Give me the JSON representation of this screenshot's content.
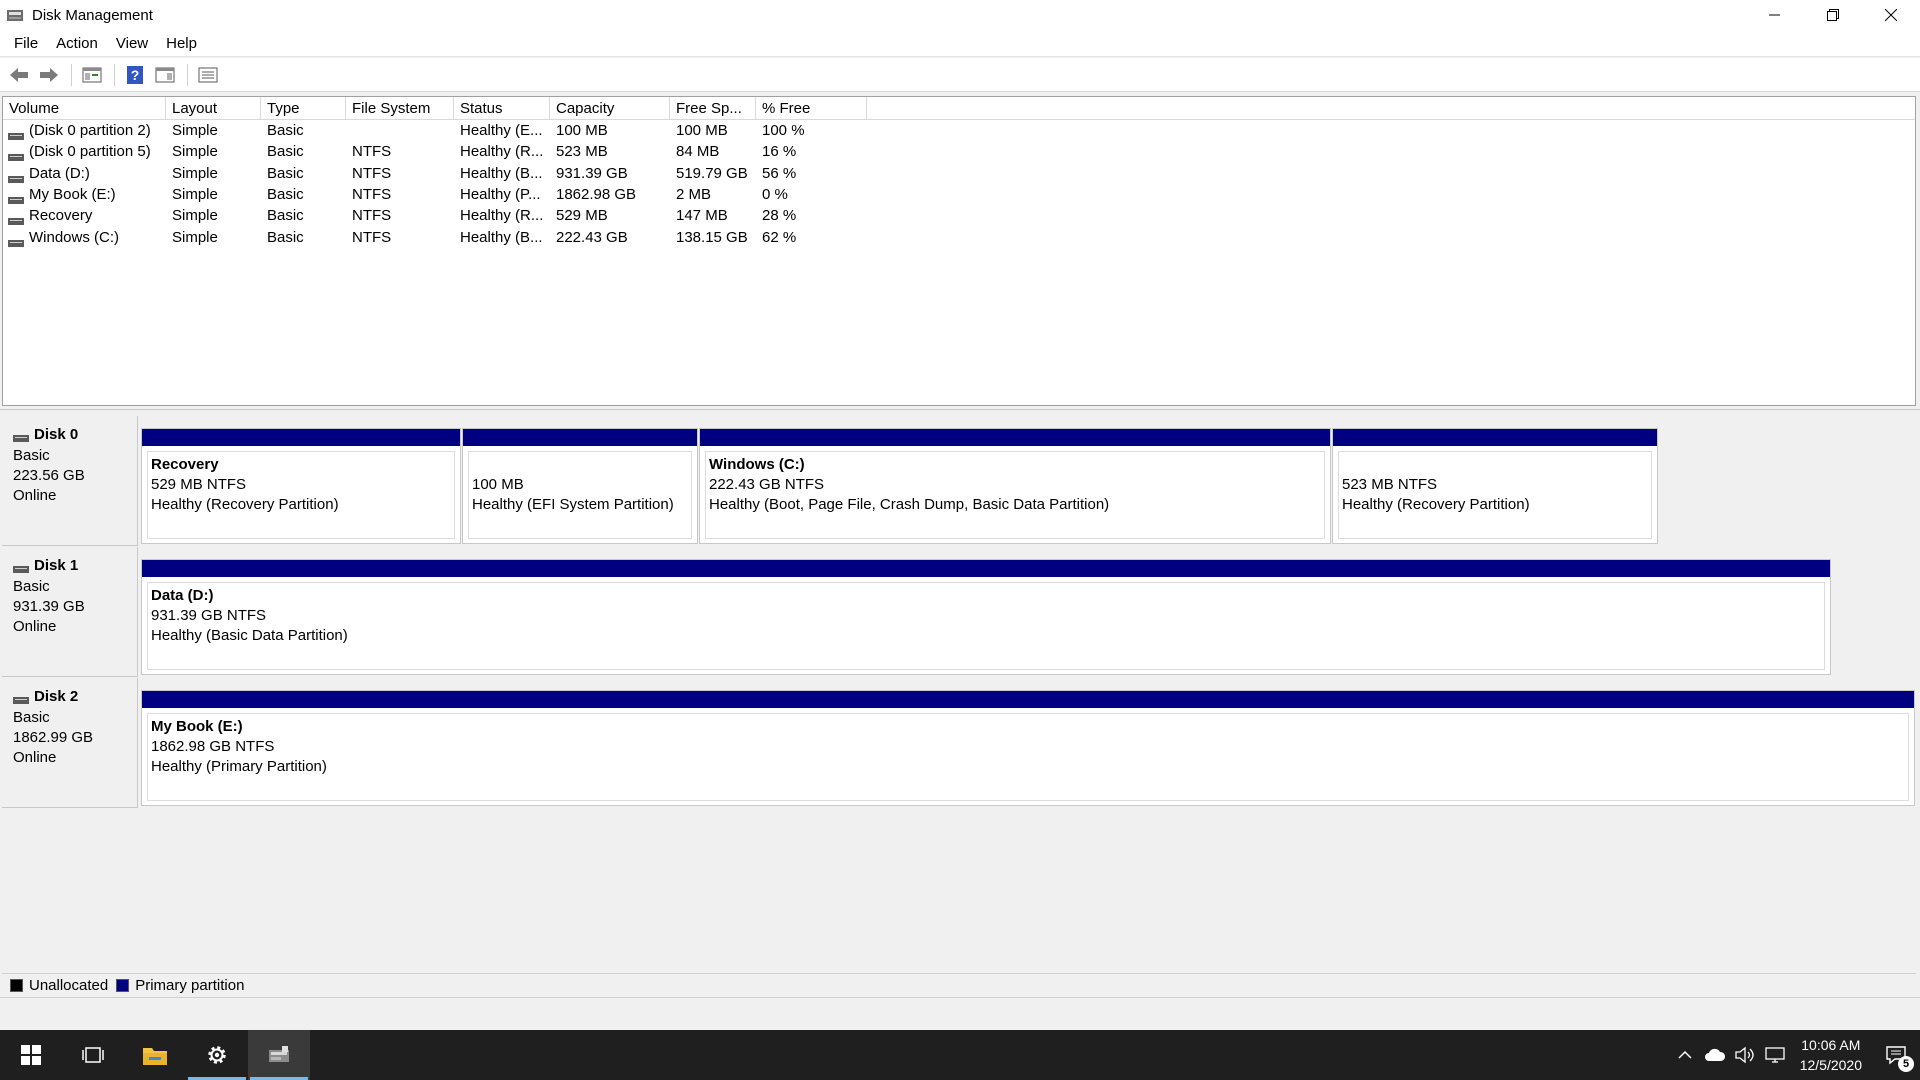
{
  "window": {
    "title": "Disk Management"
  },
  "menu": [
    "File",
    "Action",
    "View",
    "Help"
  ],
  "list": {
    "columns": [
      "Volume",
      "Layout",
      "Type",
      "File System",
      "Status",
      "Capacity",
      "Free Sp...",
      "% Free"
    ],
    "rows": [
      [
        "(Disk 0 partition 2)",
        "Simple",
        "Basic",
        "",
        "Healthy (E...",
        "100 MB",
        "100 MB",
        "100 %"
      ],
      [
        "(Disk 0 partition 5)",
        "Simple",
        "Basic",
        "NTFS",
        "Healthy (R...",
        "523 MB",
        "84 MB",
        "16 %"
      ],
      [
        "Data (D:)",
        "Simple",
        "Basic",
        "NTFS",
        "Healthy (B...",
        "931.39 GB",
        "519.79 GB",
        "56 %"
      ],
      [
        "My Book (E:)",
        "Simple",
        "Basic",
        "NTFS",
        "Healthy (P...",
        "1862.98 GB",
        "2 MB",
        "0 %"
      ],
      [
        "Recovery",
        "Simple",
        "Basic",
        "NTFS",
        "Healthy (R...",
        "529 MB",
        "147 MB",
        "28 %"
      ],
      [
        "Windows (C:)",
        "Simple",
        "Basic",
        "NTFS",
        "Healthy (B...",
        "222.43 GB",
        "138.15 GB",
        "62 %"
      ]
    ]
  },
  "disks": [
    {
      "name": "Disk 0",
      "type": "Basic",
      "size": "223.56 GB",
      "state": "Online",
      "partitions": [
        {
          "name": "Recovery",
          "size": "529 MB NTFS",
          "status": "Healthy (Recovery Partition)"
        },
        {
          "name": "",
          "size": "100 MB",
          "status": "Healthy (EFI System Partition)"
        },
        {
          "name": "Windows  (C:)",
          "size": "222.43 GB NTFS",
          "status": "Healthy (Boot, Page File, Crash Dump, Basic Data Partition)"
        },
        {
          "name": "",
          "size": "523 MB NTFS",
          "status": "Healthy (Recovery Partition)"
        }
      ]
    },
    {
      "name": "Disk 1",
      "type": "Basic",
      "size": "931.39 GB",
      "state": "Online",
      "partitions": [
        {
          "name": "Data  (D:)",
          "size": "931.39 GB NTFS",
          "status": "Healthy (Basic Data Partition)"
        }
      ]
    },
    {
      "name": "Disk 2",
      "type": "Basic",
      "size": "1862.99 GB",
      "state": "Online",
      "partitions": [
        {
          "name": "My Book  (E:)",
          "size": "1862.98 GB NTFS",
          "status": "Healthy (Primary Partition)"
        }
      ]
    }
  ],
  "legend": {
    "unallocated": "Unallocated",
    "primary": "Primary partition",
    "unallocated_color": "#000000",
    "primary_color": "#000080"
  },
  "taskbar": {
    "time": "10:06 AM",
    "date": "12/5/2020",
    "notification_count": "5"
  }
}
